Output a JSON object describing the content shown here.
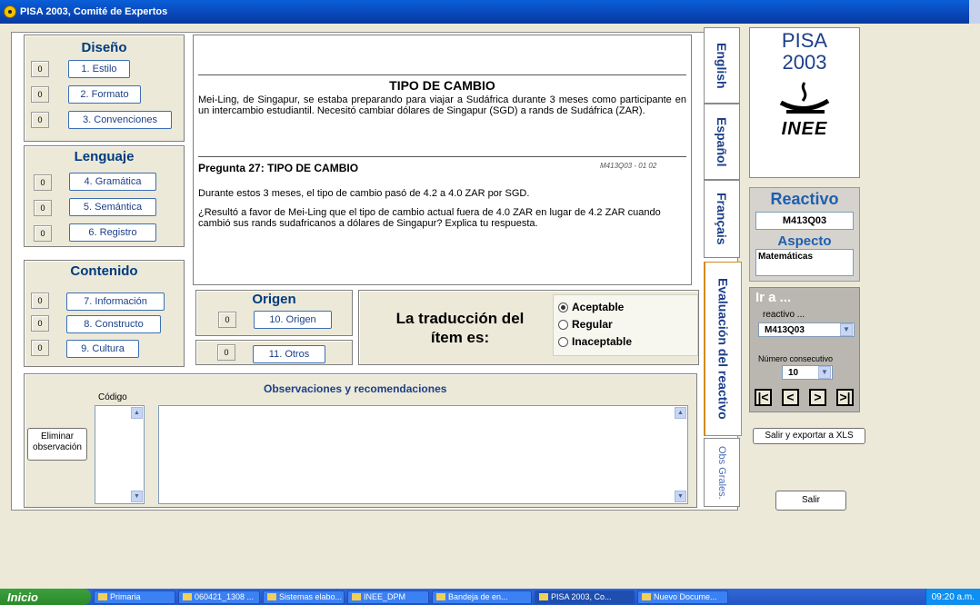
{
  "window": {
    "title": "PISA 2003, Comité de Expertos"
  },
  "diseno": {
    "heading": "Diseño",
    "items": [
      {
        "count": "0",
        "label": "1. Estilo"
      },
      {
        "count": "0",
        "label": "2. Formato"
      },
      {
        "count": "0",
        "label": "3. Convenciones"
      }
    ]
  },
  "lenguaje": {
    "heading": "Lenguaje",
    "items": [
      {
        "count": "0",
        "label": "4. Gramática"
      },
      {
        "count": "0",
        "label": "5. Semántica"
      },
      {
        "count": "0",
        "label": "6. Registro"
      }
    ]
  },
  "contenido": {
    "heading": "Contenido",
    "items": [
      {
        "count": "0",
        "label": "7. Información"
      },
      {
        "count": "0",
        "label": "8. Constructo"
      },
      {
        "count": "0",
        "label": "9. Cultura"
      }
    ]
  },
  "document": {
    "title": "TIPO DE CAMBIO",
    "intro": "Mei-Ling, de Singapur, se estaba preparando para viajar a Sudáfrica durante 3 meses como participante en un intercambio estudiantil.  Necesitó cambiar dólares de Singapur (SGD) a rands de Sudáfrica (ZAR).",
    "question_title": "Pregunta 27: TIPO DE CAMBIO",
    "question_code": "M413Q03 - 01 02",
    "para1": "Durante estos 3 meses, el tipo de cambio pasó de 4.2 a 4.0 ZAR por SGD.",
    "para2": "¿Resultó a favor de Mei-Ling que el tipo de cambio actual fuera de 4.0 ZAR en lugar de 4.2 ZAR cuando cambió sus rands sudafricanos a dólares de Singapur? Explica tu respuesta."
  },
  "origen": {
    "heading": "Origen",
    "items": [
      {
        "count": "0",
        "label": "10. Origen"
      },
      {
        "count": "0",
        "label": "11. Otros"
      }
    ]
  },
  "traduccion": {
    "label": "La traducción del ítem es:",
    "options": [
      "Aceptable",
      "Regular",
      "Inaceptable"
    ],
    "selected": "Aceptable"
  },
  "observaciones": {
    "heading": "Observaciones y recomendaciones",
    "codigo_label": "Código",
    "delete_label": "Eliminar observación"
  },
  "tabs": [
    "English",
    "Español",
    "Français",
    "Evaluación del reactivo",
    "Obs Grales."
  ],
  "logo": {
    "line1": "PISA",
    "line2": "2003",
    "org": "INEE"
  },
  "reactivo": {
    "heading": "Reactivo",
    "value": "M413Q03",
    "aspecto_heading": "Aspecto",
    "aspecto_value": "Matemáticas"
  },
  "ir_a": {
    "heading": "Ir a ...",
    "reactivo_label": "reactivo ...",
    "reactivo_value": "M413Q03",
    "consecutivo_label": "Número consecutivo",
    "consecutivo_value": "10",
    "nav": [
      "|<",
      "<",
      ">",
      ">|"
    ]
  },
  "actions": {
    "export": "Salir y exportar a XLS",
    "exit": "Salir"
  },
  "taskbar": {
    "start": "Inicio",
    "items": [
      "Primaria",
      "060421_1308 ...",
      "Sistemas elabo...",
      "INEE_DPM",
      "Bandeja de en...",
      "PISA 2003, Co...",
      "Nuevo Docume..."
    ],
    "clock": "09:20 a.m."
  }
}
